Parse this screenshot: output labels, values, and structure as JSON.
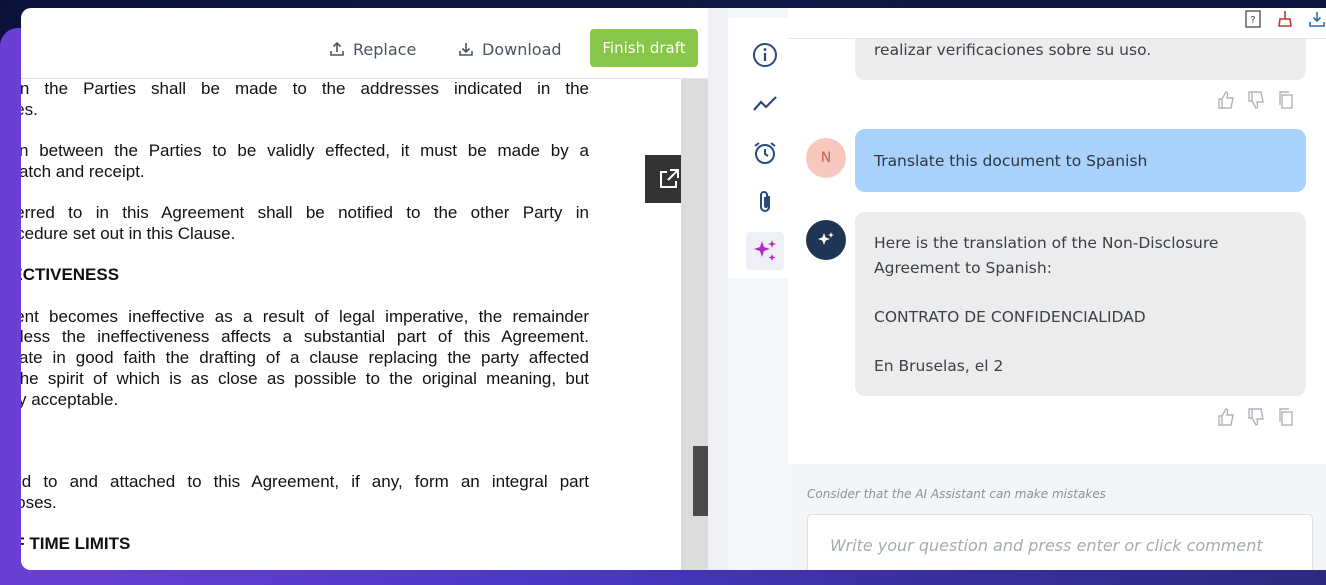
{
  "toolbar": {
    "replace_label": "Replace",
    "download_label": "Download",
    "finish_label": "Finish draft"
  },
  "document": {
    "lines": [
      {
        "text": "een the Parties shall be made to the addresses indicated in the",
        "bold": false,
        "last": false
      },
      {
        "text": "rties.",
        "bold": false,
        "last": true
      },
      {
        "text": "",
        "bold": false,
        "last": true
      },
      {
        "text": "tion between the Parties to be validly effected, it must be made by a",
        "bold": false,
        "last": false
      },
      {
        "text": "spatch and receipt.",
        "bold": false,
        "last": true
      },
      {
        "text": "",
        "bold": false,
        "last": true
      },
      {
        "text": "eferred to in this Agreement shall be notified to the other Party in",
        "bold": false,
        "last": false
      },
      {
        "text": "rocedure set out in this Clause.",
        "bold": false,
        "last": true
      },
      {
        "text": "",
        "bold": false,
        "last": true
      },
      {
        "text": "FECTIVENESS",
        "bold": true,
        "last": true
      },
      {
        "text": "",
        "bold": false,
        "last": true
      },
      {
        "text": "ment becomes ineffective as a result of legal imperative, the remainder",
        "bold": false,
        "last": false
      },
      {
        "text": "unless the ineffectiveness affects a substantial part of this Agreement.",
        "bold": false,
        "last": false
      },
      {
        "text": "otiate in good faith the drafting of a clause replacing the party affected",
        "bold": false,
        "last": false
      },
      {
        "text": ", the spirit of which is as close as possible to the original meaning, but",
        "bold": false,
        "last": false
      },
      {
        "text": "ally acceptable.",
        "bold": false,
        "last": true
      },
      {
        "text": "",
        "bold": false,
        "last": true
      },
      {
        "text": "",
        "bold": false,
        "last": true
      },
      {
        "text": "",
        "bold": false,
        "last": true
      },
      {
        "text": "rred to and attached to this Agreement, if any, form an integral part",
        "bold": false,
        "last": false
      },
      {
        "text": "rposes.",
        "bold": false,
        "last": true
      },
      {
        "text": "",
        "bold": false,
        "last": true
      },
      {
        "text": "OF TIME LIMITS",
        "bold": true,
        "last": true
      }
    ]
  },
  "chat": {
    "prev_ai_tail": "realizar verificaciones sobre su uso.",
    "user_initial": "N",
    "user_message": "Translate this document to Spanish",
    "ai_reply_intro": "Here is the translation of the Non-Disclosure Agreement to Spanish:",
    "ai_reply_title": "CONTRATO DE CONFIDENCIALIDAD",
    "ai_reply_line": "En Bruselas, el 2",
    "disclaimer": "Consider that the AI Assistant can make mistakes",
    "input_placeholder": "Write your question and press enter or click comment"
  },
  "colors": {
    "finish_button": "#88c64a",
    "user_bubble": "#a8d1fb",
    "ai_bubble": "#ececed",
    "rail_icons": "#2a4a7a",
    "ai_sparkle": "#b02bc4"
  }
}
